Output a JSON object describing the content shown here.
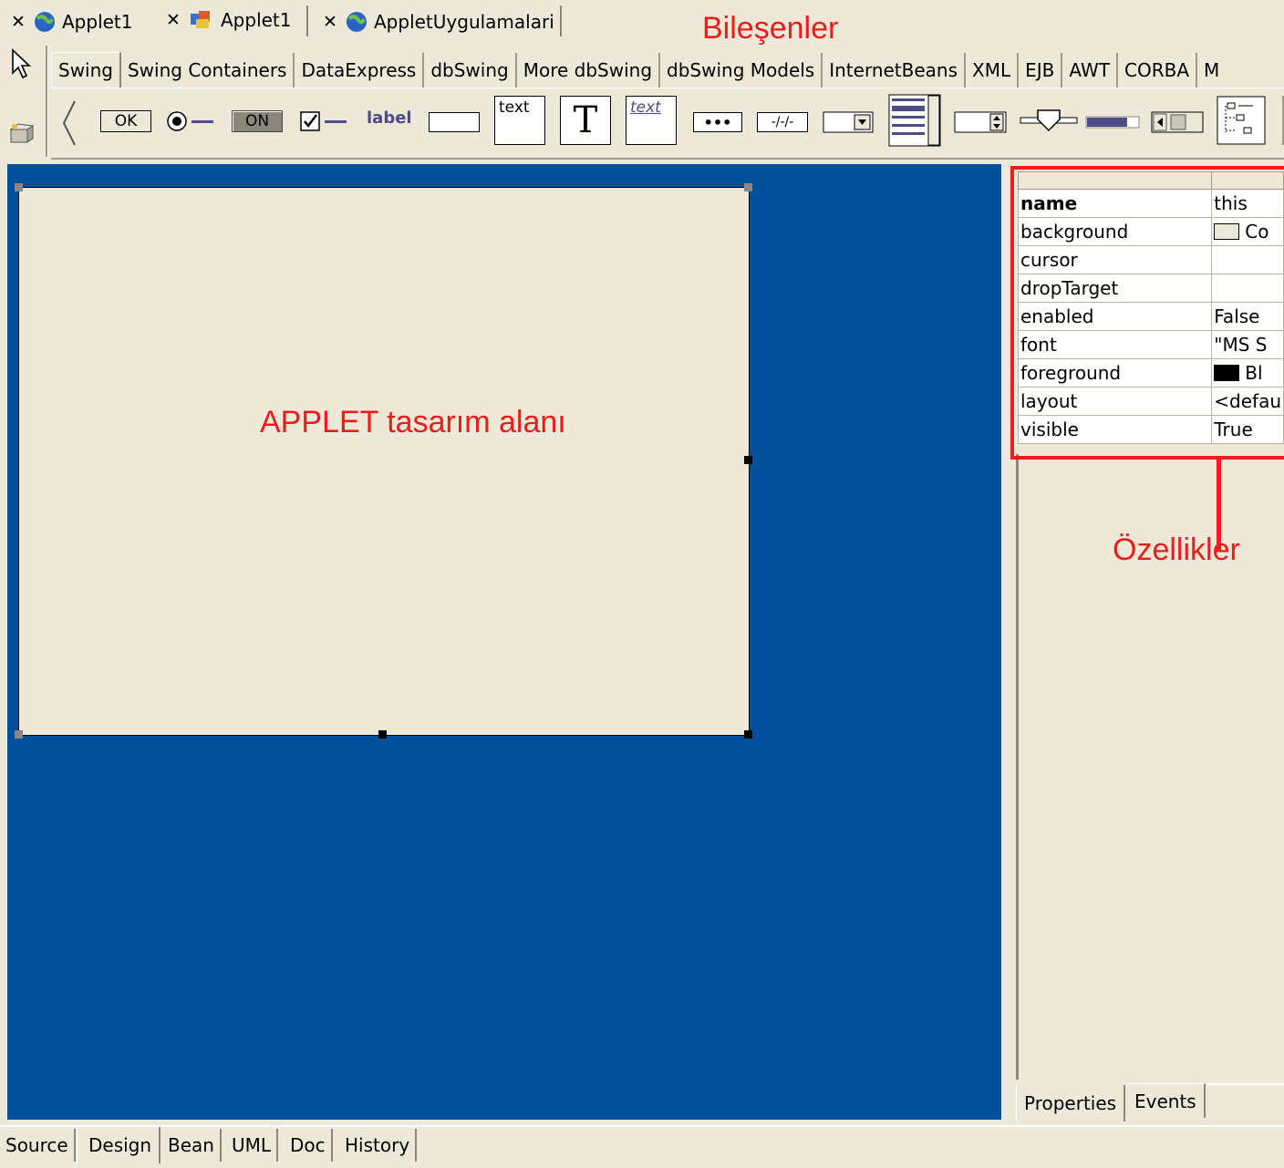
{
  "file_tabs": [
    {
      "label": "Applet1",
      "icon": "globe-applet-icon"
    },
    {
      "label": "Applet1",
      "icon": "applet-bean-icon"
    },
    {
      "label": "AppletUygulamalari",
      "icon": "globe-applet-icon"
    }
  ],
  "close_glyph": "✕",
  "palette_tabs": [
    "Swing",
    "Swing Containers",
    "DataExpress",
    "dbSwing",
    "More dbSwing",
    "dbSwing Models",
    "InternetBeans",
    "XML",
    "EJB",
    "AWT",
    "CORBA",
    "M"
  ],
  "palette_active_tab": "Swing",
  "palette_components": {
    "button": "OK",
    "toggle": "ON",
    "label": "label",
    "text_area": "text",
    "text_pane": "T",
    "editor_pane": "text",
    "password": "•••",
    "formatted": "-/-/-"
  },
  "annotations": {
    "components": "Bileşenler",
    "design_area": "APPLET tasarım alanı",
    "properties": "Özellikler"
  },
  "properties": [
    {
      "name": "name",
      "value": "this",
      "bold": true
    },
    {
      "name": "background",
      "value": "Co",
      "swatch": "#ece9d8"
    },
    {
      "name": "cursor",
      "value": ""
    },
    {
      "name": "dropTarget",
      "value": ""
    },
    {
      "name": "enabled",
      "value": "False"
    },
    {
      "name": "font",
      "value": "\"MS S"
    },
    {
      "name": "foreground",
      "value": "Bl",
      "swatch": "#000000"
    },
    {
      "name": "layout",
      "value": "<defau"
    },
    {
      "name": "visible",
      "value": "True"
    }
  ],
  "inspector_tabs": [
    "Properties",
    "Events"
  ],
  "bottom_tabs": [
    "Source",
    "Design",
    "Bean",
    "UML",
    "Doc",
    "History"
  ],
  "active_bottom_tab": "Design",
  "colors": {
    "design_background": "#00509b",
    "annotation_red": "#e8211d",
    "panel": "#ece9d8"
  }
}
